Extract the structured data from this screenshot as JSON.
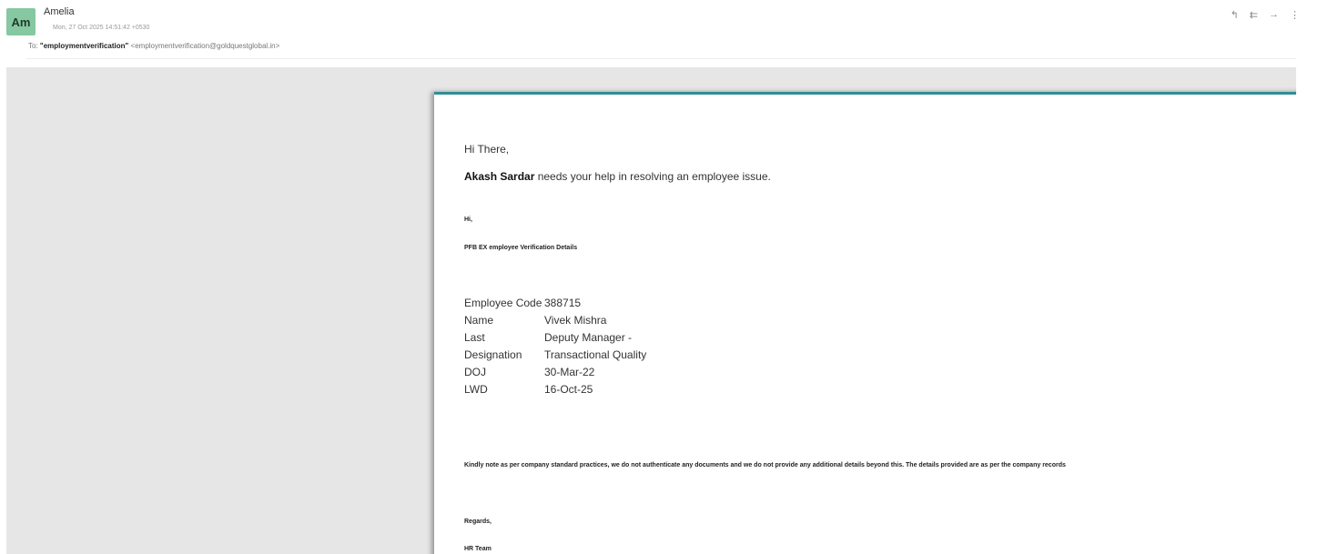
{
  "header": {
    "avatar_initials": "Am",
    "sender_name": "Amelia",
    "date": "Mon, 27 Oct 2025 14:51:42 +0530",
    "to_label": "To",
    "to_name": "\"employmentverification\"",
    "to_email": "<employmentverification@goldquestglobal.in>",
    "actions": [
      "reply-icon",
      "reply-all-icon",
      "forward-icon",
      "more-icon"
    ],
    "avatar_color": "#86c8a1"
  },
  "document": {
    "accent_color": "#2f8f94",
    "greeting": "Hi There,",
    "requester": "Akash Sardar",
    "help_text": " needs your help in resolving an employee issue.",
    "hi": "Hi,",
    "pfb": "PFB EX employee Verification Details",
    "details": [
      {
        "label": "Employee Code",
        "value": "388715"
      },
      {
        "label": "Name",
        "value": "Vivek Mishra"
      },
      {
        "label": "Last Designation",
        "value": "Deputy Manager - Transactional Quality"
      },
      {
        "label": "DOJ",
        "value": "30-Mar-22"
      },
      {
        "label": "LWD",
        "value": "16-Oct-25"
      }
    ],
    "note": "Kindly note as per company standard practices, we do not authenticate any documents and we do not provide any additional details beyond this. The details provided are as per the company records",
    "regards": "Regards,",
    "team": "HR Team"
  }
}
